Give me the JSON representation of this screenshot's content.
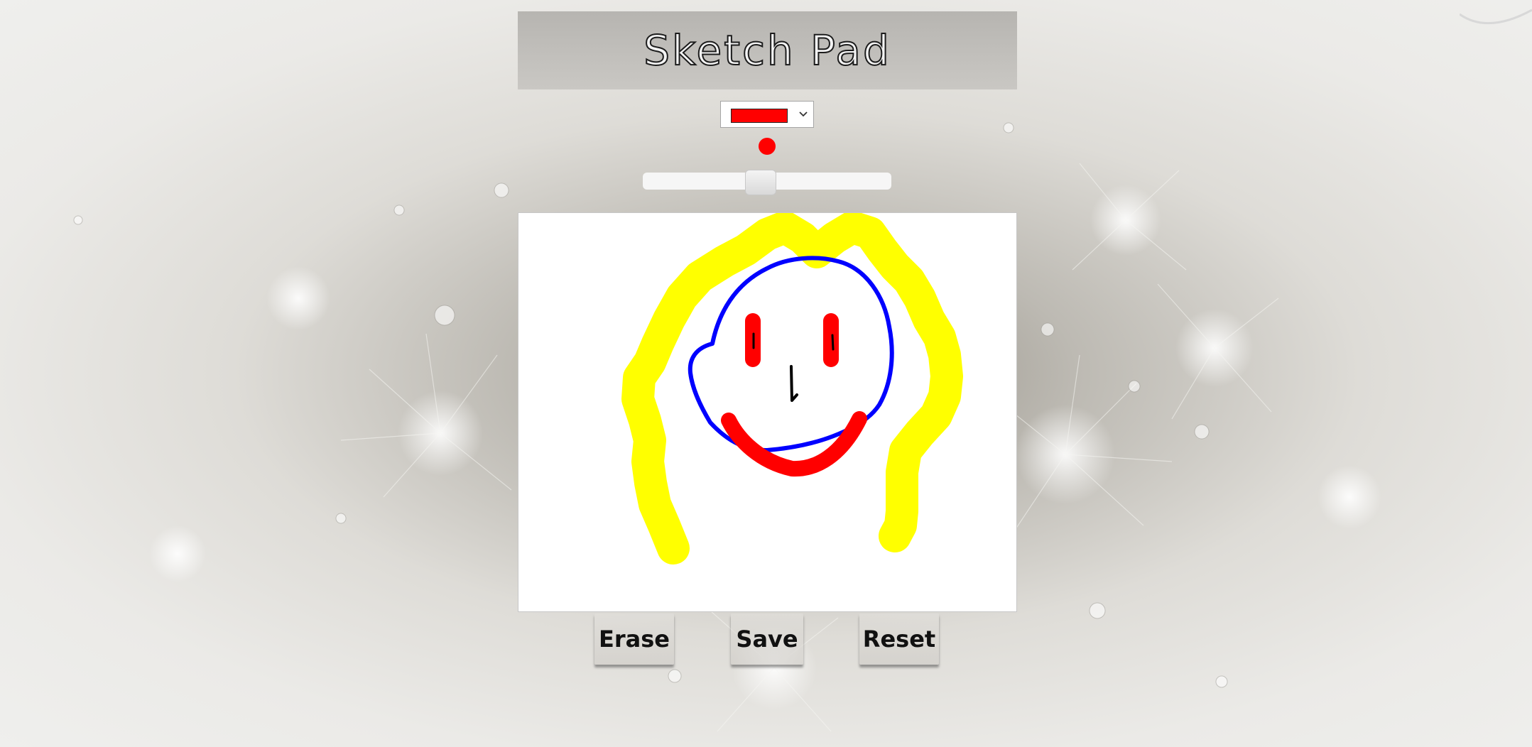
{
  "app": {
    "title": "Sketch Pad"
  },
  "toolbar": {
    "selected_color": "#ff0000",
    "brush_color": "#ff0000",
    "brush_size": 0.47
  },
  "actions": {
    "erase_label": "Erase",
    "save_label": "Save",
    "reset_label": "Reset"
  },
  "drawing": {
    "hair_color": "#ffff00",
    "face_color": "#0000ff",
    "eye_mouth_color": "#ff0000",
    "detail_color": "#000000"
  },
  "icons": {
    "dropdown": "chevron-down-icon"
  }
}
